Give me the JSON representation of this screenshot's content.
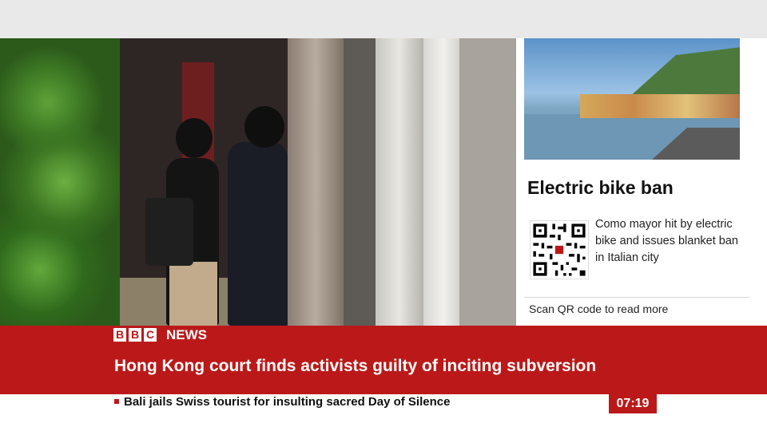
{
  "broadcast": {
    "brand": {
      "letters": [
        "B",
        "B",
        "C"
      ],
      "label": "NEWS",
      "accent_color": "#bb1919"
    },
    "headline": "Hong Kong court finds activists guilty of inciting subversion",
    "ticker": "Bali jails Swiss tourist for insulting sacred Day of Silence",
    "clock": "07:19"
  },
  "sidebar": {
    "title": "Electric bike ban",
    "description": "Como mayor hit by electric bike and issues blanket ban in Italian city",
    "scan_prompt": "Scan QR code to read more",
    "image_icon": "lakeside-town-photo",
    "qr_icon": "qr-code-icon"
  },
  "video": {
    "scene_icon": "street-footage"
  }
}
